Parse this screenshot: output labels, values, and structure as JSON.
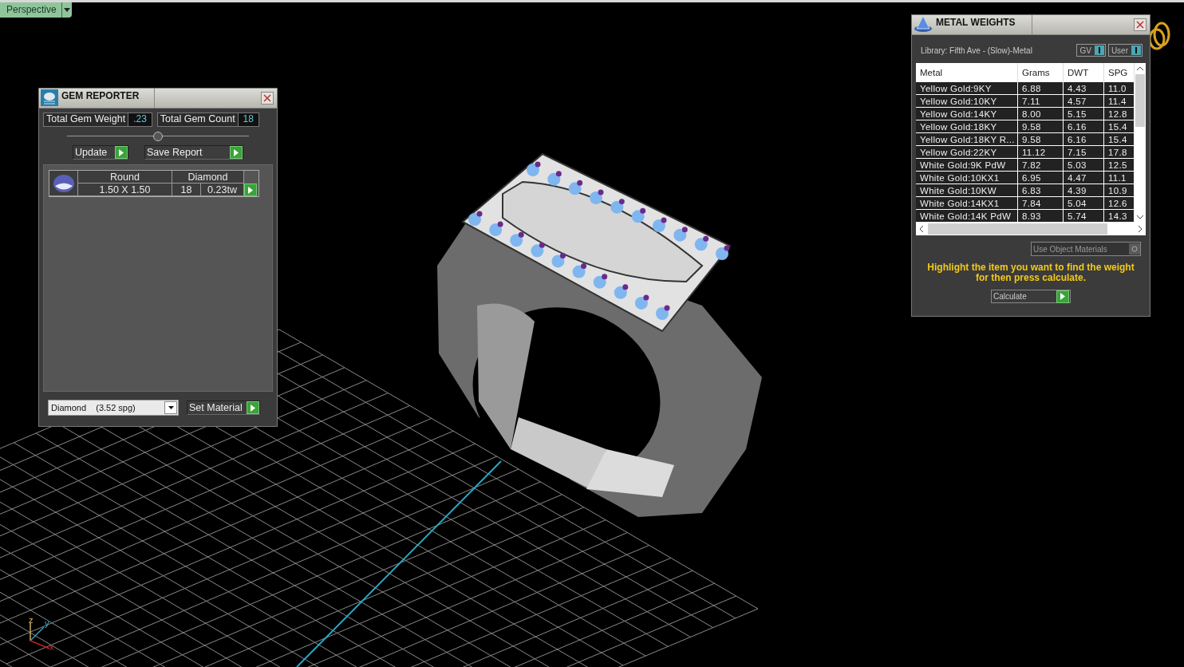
{
  "viewport": {
    "view_label": "Perspective",
    "axes": {
      "x": "x",
      "y": "y",
      "z": "z"
    }
  },
  "gem_reporter": {
    "title": "GEM REPORTER",
    "total_weight_label": "Total Gem Weight",
    "total_weight": ".23",
    "total_count_label": "Total Gem Count",
    "total_count": "18",
    "buttons": [
      "Update",
      "Save Report"
    ],
    "gems": [
      {
        "shape": "Round",
        "size": "1.50 X 1.50",
        "material": "Diamond",
        "count": "18",
        "weight": "0.23tw"
      }
    ],
    "material_select": "Diamond    (3.52 spg)",
    "set_button": "Set Material"
  },
  "metal_weights": {
    "title": "METAL WEIGHTS",
    "library": "Library: Fifth Ave - (Slow)-Metal",
    "toggles": [
      {
        "label": "GV",
        "on": true
      },
      {
        "label": "User",
        "on": true
      }
    ],
    "columns": [
      "Metal",
      "Grams",
      "DWT",
      "SPG"
    ],
    "rows": [
      [
        "Yellow Gold:9KY",
        "6.88",
        "4.43",
        "11.0"
      ],
      [
        "Yellow Gold:10KY",
        "7.11",
        "4.57",
        "11.4"
      ],
      [
        "Yellow Gold:14KY",
        "8.00",
        "5.15",
        "12.8"
      ],
      [
        "Yellow Gold:18KY",
        "9.58",
        "6.16",
        "15.4"
      ],
      [
        "Yellow Gold:18KY R...",
        "9.58",
        "6.16",
        "15.4"
      ],
      [
        "Yellow Gold:22KY",
        "11.12",
        "7.15",
        "17.8"
      ],
      [
        "White Gold:9K PdW",
        "7.82",
        "5.03",
        "12.5"
      ],
      [
        "White Gold:10KX1",
        "6.95",
        "4.47",
        "11.1"
      ],
      [
        "White Gold:10KW",
        "6.83",
        "4.39",
        "10.9"
      ],
      [
        "White Gold:14KX1",
        "7.84",
        "5.04",
        "12.6"
      ],
      [
        "White Gold:14K PdW",
        "8.93",
        "5.74",
        "14.3"
      ]
    ],
    "use_object_materials": {
      "label": "Use Object Materials",
      "checked": false
    },
    "hint": "Highlight the item you want to find the weight for then press calculate.",
    "calculate_button": "Calculate"
  }
}
